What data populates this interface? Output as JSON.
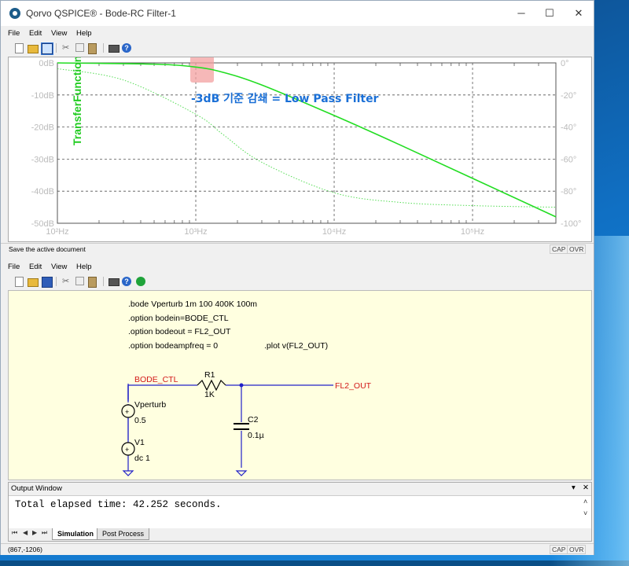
{
  "window": {
    "title": "Qorvo QSPICE® - Bode-RC Filter-1",
    "minimize": "─",
    "maximize": "☐",
    "close": "✕"
  },
  "menu_top": [
    "File",
    "Edit",
    "View",
    "Help"
  ],
  "menu_bottom": [
    "File",
    "Edit",
    "View",
    "Help"
  ],
  "plot": {
    "ylabel": "TransferFunction",
    "annotation": "-3dB 기준 감쇄 = Low Pass Filter",
    "colors": {
      "magnitude": "#22dd22",
      "phase": "#55dd55",
      "grid": "#555555",
      "axis_text": "#bbbbbb",
      "annotation": "#1a6fd6",
      "marker": "#f3a0a0"
    }
  },
  "chart_data": {
    "type": "line",
    "x_scale": "log",
    "xlim": [
      100,
      400000
    ],
    "x_ticks": [
      "10²Hz",
      "10³Hz",
      "10⁴Hz",
      "10⁵Hz"
    ],
    "y_ticks_left": [
      "0dB",
      "-10dB",
      "-20dB",
      "-30dB",
      "-40dB",
      "-50dB"
    ],
    "y_ticks_right": [
      "0°",
      "-20°",
      "-40°",
      "-60°",
      "-80°",
      "-100°"
    ],
    "ylim_left": [
      -50,
      0
    ],
    "ylim_right": [
      -100,
      0
    ],
    "grid": true,
    "series": [
      {
        "style": "solid",
        "axis": "left",
        "x": [
          100,
          500,
          1000,
          1592,
          3000,
          10000,
          30000,
          100000,
          400000
        ],
        "y": [
          0,
          -0.4,
          -1.3,
          -3,
          -6.9,
          -16.4,
          -25.6,
          -36,
          -48
        ]
      },
      {
        "style": "dotted",
        "axis": "right",
        "x": [
          100,
          300,
          1000,
          1592,
          3000,
          10000,
          30000,
          100000,
          400000
        ],
        "y": [
          -3.6,
          -10.7,
          -32,
          -45,
          -62,
          -81,
          -87,
          -89,
          -90
        ]
      }
    ]
  },
  "status_top": {
    "message": "Save the active document",
    "cap": "CAP",
    "ovr": "OVR"
  },
  "schematic": {
    "directives": [
      ".bode Vperturb 1m 100 400K 100m",
      ".option bodein=BODE_CTL",
      ".option bodeout = FL2_OUT",
      ".option bodeampfreq = 0"
    ],
    "plot_directive": ".plot v(FL2_OUT)",
    "net_in": "BODE_CTL",
    "net_out": "FL2_OUT",
    "r1_name": "R1",
    "r1_value": "1K",
    "c2_name": "C2",
    "c2_value": "0.1µ",
    "vperturb_name": "Vperturb",
    "vperturb_value": "0.5",
    "v1_name": "V1",
    "v1_value": "dc 1"
  },
  "output": {
    "title": "Output Window",
    "pin": "▾",
    "close": "✕",
    "text": "Total elapsed time: 42.252 seconds.",
    "tabs": [
      "Simulation",
      "Post Process"
    ]
  },
  "status_bottom": {
    "coords": "(867,-1206)",
    "cap": "CAP",
    "ovr": "OVR"
  }
}
